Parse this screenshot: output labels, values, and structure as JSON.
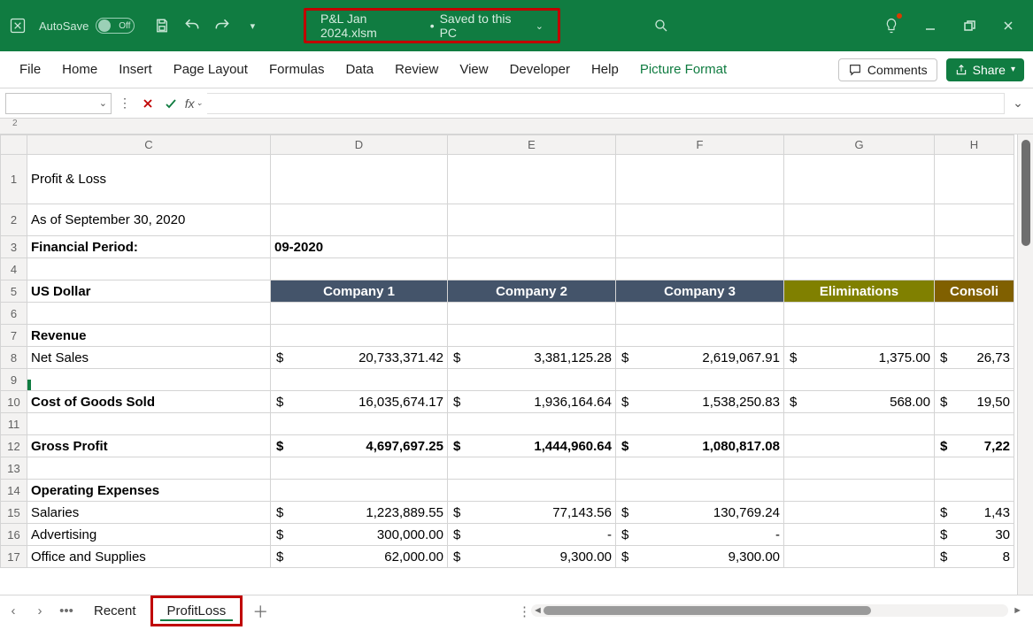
{
  "titlebar": {
    "autosave_label": "AutoSave",
    "autosave_state": "Off",
    "filename": "P&L Jan 2024.xlsm",
    "save_status": "Saved to this PC"
  },
  "ribbon": {
    "tabs": [
      "File",
      "Home",
      "Insert",
      "Page Layout",
      "Formulas",
      "Data",
      "Review",
      "View",
      "Developer",
      "Help",
      "Picture Format"
    ],
    "active_tab": "Picture Format",
    "comments_label": "Comments",
    "share_label": "Share"
  },
  "formulabar": {
    "namebox_value": "",
    "fx_label": "fx",
    "formula_value": ""
  },
  "columns": [
    "C",
    "D",
    "E",
    "F",
    "G",
    "H"
  ],
  "rows": {
    "r1": {
      "C": "Profit & Loss"
    },
    "r2": {
      "C": "As of September 30, 2020"
    },
    "r3": {
      "C": "Financial Period:",
      "D": "09-2020"
    },
    "r4": {},
    "r5": {
      "C": "US Dollar",
      "D": "Company 1",
      "E": "Company 2",
      "F": "Company 3",
      "G": "Eliminations",
      "H": "Consoli"
    },
    "r6": {},
    "r7": {
      "C": "Revenue"
    },
    "r8": {
      "C": "Net Sales",
      "D": "20,733,371.42",
      "E": "3,381,125.28",
      "F": "2,619,067.91",
      "G": "1,375.00",
      "H": "26,73"
    },
    "r9": {},
    "r10": {
      "C": "Cost of Goods Sold",
      "D": "16,035,674.17",
      "E": "1,936,164.64",
      "F": "1,538,250.83",
      "G": "568.00",
      "H": "19,50"
    },
    "r11": {},
    "r12": {
      "C": "Gross Profit",
      "D": "4,697,697.25",
      "E": "1,444,960.64",
      "F": "1,080,817.08",
      "G": "",
      "H": "7,22"
    },
    "r13": {},
    "r14": {
      "C": "Operating Expenses"
    },
    "r15": {
      "C": "Salaries",
      "D": "1,223,889.55",
      "E": "77,143.56",
      "F": "130,769.24",
      "G": "",
      "H": "1,43"
    },
    "r16": {
      "C": "Advertising",
      "D": "300,000.00",
      "E": "-",
      "F": "-",
      "G": "",
      "H": "30"
    },
    "r17": {
      "C": "Office and Supplies",
      "D": "62,000.00",
      "E": "9,300.00",
      "F": "9,300.00",
      "G": "",
      "H": "8"
    }
  },
  "sheet_tabs": {
    "recent": "Recent",
    "active": "ProfitLoss"
  },
  "stub_number": "2"
}
